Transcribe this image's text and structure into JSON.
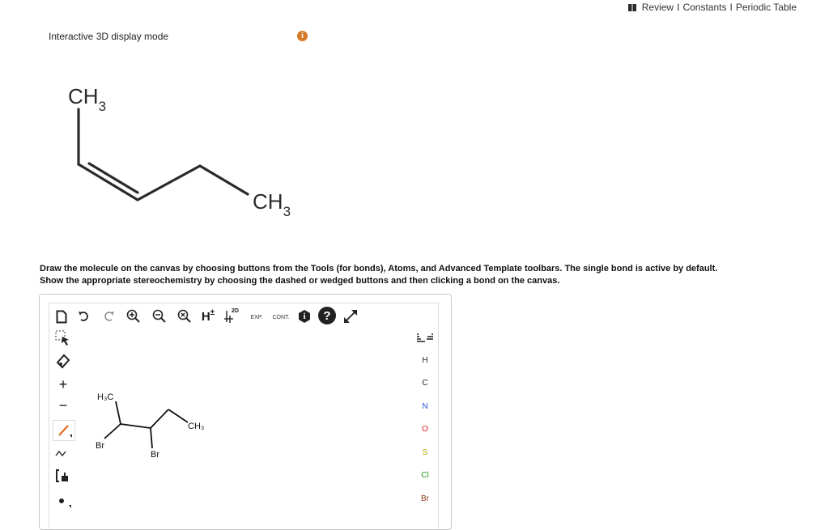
{
  "nav": {
    "review": "Review",
    "separator": "I",
    "constants": "Constants",
    "periodic": "Periodic Table"
  },
  "mode_label": "Interactive 3D display mode",
  "info_glyph": "i",
  "molecule": {
    "top_group": "CH",
    "top_sub": "3",
    "right_group": "CH",
    "right_sub": "3"
  },
  "instructions": {
    "line1": "Draw the molecule on the canvas by choosing buttons from the Tools (for bonds), Atoms, and Advanced Template toolbars. The single bond is active by default.",
    "line2": "Show the appropriate stereochemistry by choosing the dashed or wedged buttons and then clicking a bond on the canvas."
  },
  "toolbar": {
    "h_label": "H",
    "h_sup": "±",
    "twod_label": "2D",
    "exp_label": "EXP.",
    "cont_label": "CONT.",
    "info_glyph": "i",
    "help_glyph": "?"
  },
  "left_tools": {
    "plus": "+",
    "minus": "−"
  },
  "atoms": [
    "H",
    "C",
    "N",
    "O",
    "S",
    "Cl",
    "Br"
  ],
  "canvas_molecule": {
    "h3c": "H₃C",
    "ch3": "CH₃",
    "br1": "Br",
    "br2": "Br"
  },
  "colors": {
    "info_orange": "#d67a2a",
    "accent_orange": "#e0702a",
    "nitrogen": "#1f4fd6",
    "oxygen": "#d61f1f",
    "sulfur": "#b8a200",
    "chlorine": "#1a9a1a",
    "bromine": "#8a3b1a"
  }
}
